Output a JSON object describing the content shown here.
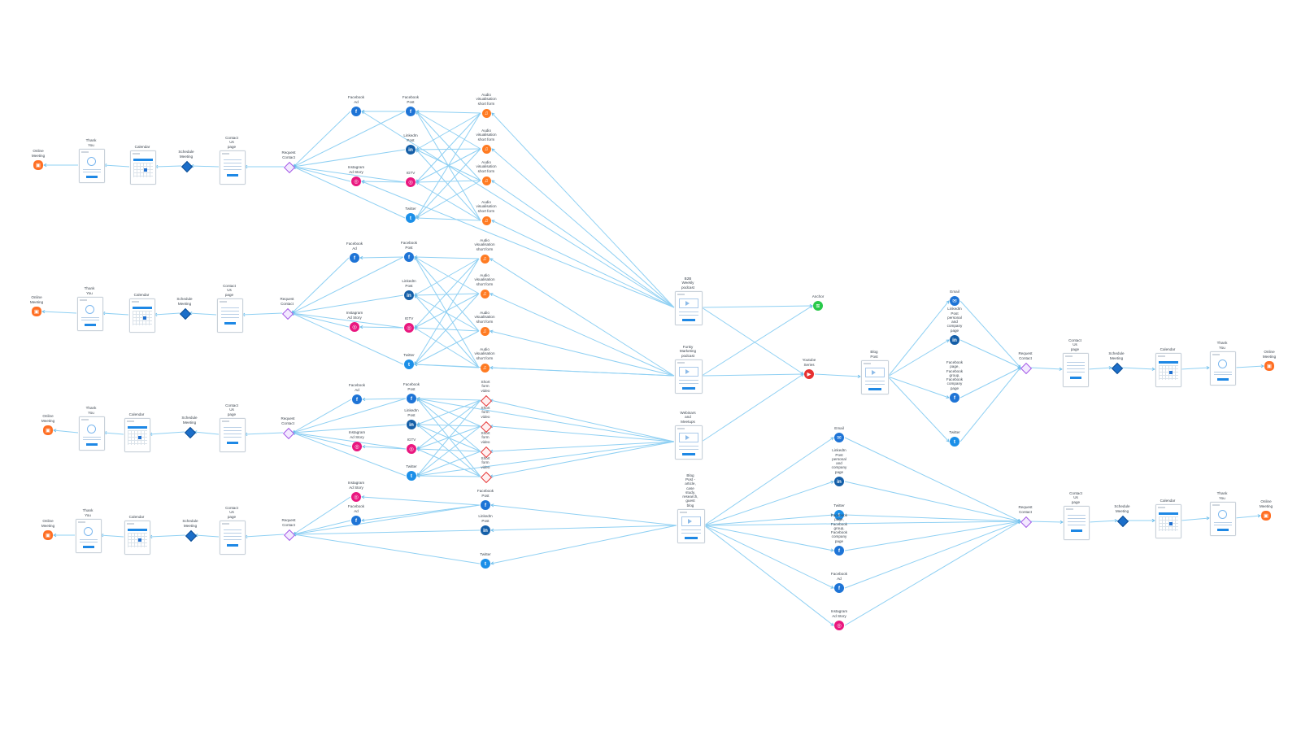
{
  "nodes": [
    {
      "id": "r1_mtg",
      "kind": "meeting",
      "label": "Online Meeting"
    },
    {
      "id": "r1_ty",
      "kind": "page-thanks",
      "label": "Thank You"
    },
    {
      "id": "r1_cal",
      "kind": "page-calendar",
      "label": "Calendar"
    },
    {
      "id": "r1_sch",
      "kind": "schedule",
      "label": "Schedule Meeting"
    },
    {
      "id": "r1_cu",
      "kind": "page-contact",
      "label": "Contact Us page"
    },
    {
      "id": "r1_rc",
      "kind": "request",
      "label": "Request Contact"
    },
    {
      "id": "r1_fbad",
      "kind": "fb",
      "label": "Facebook Ad"
    },
    {
      "id": "r1_igad",
      "kind": "ig",
      "label": "Instagram Ad Story"
    },
    {
      "id": "r1_fbp",
      "kind": "fb",
      "label": "Facebook Post"
    },
    {
      "id": "r1_li",
      "kind": "li",
      "label": "LinkedIn Post"
    },
    {
      "id": "r1_igtv",
      "kind": "ig",
      "label": "IGTV"
    },
    {
      "id": "r1_tw",
      "kind": "tw",
      "label": "Twitter"
    },
    {
      "id": "r1_a1",
      "kind": "audio",
      "label": "Audio visualisation\nshort form"
    },
    {
      "id": "r1_a2",
      "kind": "audio",
      "label": "Audio visualisation\nshort form"
    },
    {
      "id": "r1_a3",
      "kind": "audio",
      "label": "Audio visualisation\nshort form"
    },
    {
      "id": "r1_a4",
      "kind": "audio",
      "label": "Audio visualisation\nshort form"
    },
    {
      "id": "r2_mtg",
      "kind": "meeting",
      "label": "Online Meeting"
    },
    {
      "id": "r2_ty",
      "kind": "page-thanks",
      "label": "Thank You"
    },
    {
      "id": "r2_cal",
      "kind": "page-calendar",
      "label": "Calendar"
    },
    {
      "id": "r2_sch",
      "kind": "schedule",
      "label": "Schedule Meeting"
    },
    {
      "id": "r2_cu",
      "kind": "page-contact",
      "label": "Contact Us page"
    },
    {
      "id": "r2_rc",
      "kind": "request",
      "label": "Request Contact"
    },
    {
      "id": "r2_fbad",
      "kind": "fb",
      "label": "Facebook Ad"
    },
    {
      "id": "r2_igad",
      "kind": "ig",
      "label": "Instagram Ad Story"
    },
    {
      "id": "r2_fbp",
      "kind": "fb",
      "label": "Facebook Post"
    },
    {
      "id": "r2_li",
      "kind": "li",
      "label": "LinkedIn Post"
    },
    {
      "id": "r2_igtv",
      "kind": "ig",
      "label": "IGTV"
    },
    {
      "id": "r2_tw",
      "kind": "tw",
      "label": "Twitter"
    },
    {
      "id": "r2_a1",
      "kind": "audio",
      "label": "Audio visualisation\nshort form"
    },
    {
      "id": "r2_a2",
      "kind": "audio",
      "label": "Audio visualisation\nshort form"
    },
    {
      "id": "r2_a3",
      "kind": "audio",
      "label": "Audio visualisation\nshort form"
    },
    {
      "id": "r2_a4",
      "kind": "audio",
      "label": "Audio visualisation\nshort form"
    },
    {
      "id": "r3_mtg",
      "kind": "meeting",
      "label": "Online Meeting"
    },
    {
      "id": "r3_ty",
      "kind": "page-thanks",
      "label": "Thank You"
    },
    {
      "id": "r3_cal",
      "kind": "page-calendar",
      "label": "Calendar"
    },
    {
      "id": "r3_sch",
      "kind": "schedule",
      "label": "Schedule Meeting"
    },
    {
      "id": "r3_cu",
      "kind": "page-contact",
      "label": "Contact Us page"
    },
    {
      "id": "r3_rc",
      "kind": "request",
      "label": "Request Contact"
    },
    {
      "id": "r3_fbad",
      "kind": "fb",
      "label": "Facebook Ad"
    },
    {
      "id": "r3_igad",
      "kind": "ig",
      "label": "Instagram Ad Story"
    },
    {
      "id": "r3_fbp",
      "kind": "fb",
      "label": "Facebook Post"
    },
    {
      "id": "r3_li",
      "kind": "li",
      "label": "LinkedIn Post"
    },
    {
      "id": "r3_igtv",
      "kind": "ig",
      "label": "IGTV"
    },
    {
      "id": "r3_tw",
      "kind": "tw",
      "label": "Twitter"
    },
    {
      "id": "r3_s1",
      "kind": "video",
      "label": "Short form video"
    },
    {
      "id": "r3_s2",
      "kind": "video",
      "label": "Short form video"
    },
    {
      "id": "r3_s3",
      "kind": "video",
      "label": "Short form video"
    },
    {
      "id": "r3_s4",
      "kind": "video",
      "label": "Short form video"
    },
    {
      "id": "r4_mtg",
      "kind": "meeting",
      "label": "Online Meeting"
    },
    {
      "id": "r4_ty",
      "kind": "page-thanks",
      "label": "Thank You"
    },
    {
      "id": "r4_cal",
      "kind": "page-calendar",
      "label": "Calendar"
    },
    {
      "id": "r4_sch",
      "kind": "schedule",
      "label": "Schedule Meeting"
    },
    {
      "id": "r4_cu",
      "kind": "page-contact",
      "label": "Contact Us page"
    },
    {
      "id": "r4_rc",
      "kind": "request",
      "label": "Request Contact"
    },
    {
      "id": "r4_igad",
      "kind": "ig",
      "label": "Instagram Ad Story"
    },
    {
      "id": "r4_fbad",
      "kind": "fb",
      "label": "Facebook Ad"
    },
    {
      "id": "r4_fbp",
      "kind": "fb",
      "label": "Facebook Post"
    },
    {
      "id": "r4_li",
      "kind": "li",
      "label": "LinkedIn Post"
    },
    {
      "id": "r4_tw",
      "kind": "tw",
      "label": "Twitter"
    },
    {
      "id": "pod_b2b",
      "kind": "page-media",
      "label": "B2B Weekly podcast"
    },
    {
      "id": "pod_funky",
      "kind": "page-media",
      "label": "Funky Marketing podcast"
    },
    {
      "id": "webinar",
      "kind": "page-media",
      "label": "Webinars and Meetups"
    },
    {
      "id": "blog_long",
      "kind": "page-media",
      "label": "Blog Post - article, case study, research, guest blog"
    },
    {
      "id": "anchor",
      "kind": "anchor",
      "label": "Anchor"
    },
    {
      "id": "yt",
      "kind": "youtube",
      "label": "Youtube Series"
    },
    {
      "id": "blog",
      "kind": "page-media",
      "label": "Blog Post"
    },
    {
      "id": "u_email",
      "kind": "email",
      "label": "Email"
    },
    {
      "id": "u_li",
      "kind": "li",
      "label": "LinkedIn Post personal and\ncompany page"
    },
    {
      "id": "u_fb",
      "kind": "fb",
      "label": "Facebook page, Facebook\ngroup, Facebook company\npage"
    },
    {
      "id": "u_tw",
      "kind": "tw",
      "label": "Twitter"
    },
    {
      "id": "u_rc",
      "kind": "request",
      "label": "Request Contact"
    },
    {
      "id": "u_cu",
      "kind": "page-contact",
      "label": "Contact Us page"
    },
    {
      "id": "u_sch",
      "kind": "schedule",
      "label": "Schedule Meeting"
    },
    {
      "id": "u_cal",
      "kind": "page-calendar",
      "label": "Calendar"
    },
    {
      "id": "u_ty",
      "kind": "page-thanks",
      "label": "Thank You"
    },
    {
      "id": "u_mtg",
      "kind": "meeting",
      "label": "Online Meeting"
    },
    {
      "id": "l_email",
      "kind": "email",
      "label": "Email"
    },
    {
      "id": "l_li",
      "kind": "li",
      "label": "LinkedIn Post personal and\ncompany page"
    },
    {
      "id": "l_tw",
      "kind": "tw",
      "label": "Twitter"
    },
    {
      "id": "l_fb",
      "kind": "fb",
      "label": "Facebook page, Facebook\ngroup, Facebook company\npage"
    },
    {
      "id": "l_fbad",
      "kind": "fb",
      "label": "Facebook Ad"
    },
    {
      "id": "l_igad",
      "kind": "ig",
      "label": "Instagram Ad Story"
    },
    {
      "id": "l_rc",
      "kind": "request",
      "label": "Request Contact"
    },
    {
      "id": "l_cu",
      "kind": "page-contact",
      "label": "Contact Us page"
    },
    {
      "id": "l_sch",
      "kind": "schedule",
      "label": "Schedule Meeting"
    },
    {
      "id": "l_cal",
      "kind": "page-calendar",
      "label": "Calendar"
    },
    {
      "id": "l_ty",
      "kind": "page-thanks",
      "label": "Thank You"
    },
    {
      "id": "l_mtg",
      "kind": "meeting",
      "label": "Online Meeting"
    }
  ],
  "edges": [
    [
      "r1_ty",
      "r1_mtg"
    ],
    [
      "r1_cal",
      "r1_ty"
    ],
    [
      "r1_sch",
      "r1_cal"
    ],
    [
      "r1_cu",
      "r1_sch"
    ],
    [
      "r1_rc",
      "r1_cu"
    ],
    [
      "r1_fbad",
      "r1_rc"
    ],
    [
      "r1_igad",
      "r1_rc"
    ],
    [
      "r1_fbp",
      "r1_rc"
    ],
    [
      "r1_li",
      "r1_rc"
    ],
    [
      "r1_igtv",
      "r1_rc"
    ],
    [
      "r1_tw",
      "r1_rc"
    ],
    [
      "r1_fbp",
      "r1_fbad"
    ],
    [
      "r1_igtv",
      "r1_igad"
    ],
    [
      "r1_a1",
      "r1_fbp"
    ],
    [
      "r1_a1",
      "r1_li"
    ],
    [
      "r1_a1",
      "r1_igtv"
    ],
    [
      "r1_a1",
      "r1_tw"
    ],
    [
      "r1_a2",
      "r1_fbp"
    ],
    [
      "r1_a2",
      "r1_li"
    ],
    [
      "r1_a2",
      "r1_igtv"
    ],
    [
      "r1_a2",
      "r1_tw"
    ],
    [
      "r1_a3",
      "r1_fbp"
    ],
    [
      "r1_a3",
      "r1_li"
    ],
    [
      "r1_a3",
      "r1_igtv"
    ],
    [
      "r1_a3",
      "r1_tw"
    ],
    [
      "r1_a4",
      "r1_fbp"
    ],
    [
      "r1_a4",
      "r1_li"
    ],
    [
      "r1_a4",
      "r1_igtv"
    ],
    [
      "r1_a4",
      "r1_tw"
    ],
    [
      "pod_b2b",
      "r1_a1"
    ],
    [
      "pod_b2b",
      "r1_a2"
    ],
    [
      "pod_b2b",
      "r1_a3"
    ],
    [
      "pod_b2b",
      "r1_a4"
    ],
    [
      "pod_b2b",
      "r1_fbad"
    ],
    [
      "pod_b2b",
      "r1_igad"
    ],
    [
      "r2_ty",
      "r2_mtg"
    ],
    [
      "r2_cal",
      "r2_ty"
    ],
    [
      "r2_sch",
      "r2_cal"
    ],
    [
      "r2_cu",
      "r2_sch"
    ],
    [
      "r2_rc",
      "r2_cu"
    ],
    [
      "r2_fbad",
      "r2_rc"
    ],
    [
      "r2_igad",
      "r2_rc"
    ],
    [
      "r2_fbp",
      "r2_rc"
    ],
    [
      "r2_li",
      "r2_rc"
    ],
    [
      "r2_igtv",
      "r2_rc"
    ],
    [
      "r2_tw",
      "r2_rc"
    ],
    [
      "r2_fbp",
      "r2_fbad"
    ],
    [
      "r2_igtv",
      "r2_igad"
    ],
    [
      "r2_a1",
      "r2_fbp"
    ],
    [
      "r2_a1",
      "r2_li"
    ],
    [
      "r2_a1",
      "r2_igtv"
    ],
    [
      "r2_a1",
      "r2_tw"
    ],
    [
      "r2_a2",
      "r2_fbp"
    ],
    [
      "r2_a2",
      "r2_li"
    ],
    [
      "r2_a2",
      "r2_igtv"
    ],
    [
      "r2_a2",
      "r2_tw"
    ],
    [
      "r2_a3",
      "r2_fbp"
    ],
    [
      "r2_a3",
      "r2_li"
    ],
    [
      "r2_a3",
      "r2_igtv"
    ],
    [
      "r2_a3",
      "r2_tw"
    ],
    [
      "r2_a4",
      "r2_fbp"
    ],
    [
      "r2_a4",
      "r2_li"
    ],
    [
      "r2_a4",
      "r2_igtv"
    ],
    [
      "r2_a4",
      "r2_tw"
    ],
    [
      "pod_funky",
      "r2_a1"
    ],
    [
      "pod_funky",
      "r2_a2"
    ],
    [
      "pod_funky",
      "r2_a3"
    ],
    [
      "pod_funky",
      "r2_a4"
    ],
    [
      "pod_funky",
      "r2_tw"
    ],
    [
      "r3_ty",
      "r3_mtg"
    ],
    [
      "r3_cal",
      "r3_ty"
    ],
    [
      "r3_sch",
      "r3_cal"
    ],
    [
      "r3_cu",
      "r3_sch"
    ],
    [
      "r3_rc",
      "r3_cu"
    ],
    [
      "r3_fbad",
      "r3_rc"
    ],
    [
      "r3_igad",
      "r3_rc"
    ],
    [
      "r3_fbp",
      "r3_rc"
    ],
    [
      "r3_li",
      "r3_rc"
    ],
    [
      "r3_igtv",
      "r3_rc"
    ],
    [
      "r3_tw",
      "r3_rc"
    ],
    [
      "r3_fbp",
      "r3_fbad"
    ],
    [
      "r3_igtv",
      "r3_igad"
    ],
    [
      "r3_s1",
      "r3_fbp"
    ],
    [
      "r3_s1",
      "r3_li"
    ],
    [
      "r3_s1",
      "r3_igtv"
    ],
    [
      "r3_s1",
      "r3_tw"
    ],
    [
      "r3_s2",
      "r3_fbp"
    ],
    [
      "r3_s2",
      "r3_li"
    ],
    [
      "r3_s2",
      "r3_igtv"
    ],
    [
      "r3_s2",
      "r3_tw"
    ],
    [
      "r3_s3",
      "r3_fbp"
    ],
    [
      "r3_s3",
      "r3_li"
    ],
    [
      "r3_s3",
      "r3_igtv"
    ],
    [
      "r3_s3",
      "r3_tw"
    ],
    [
      "r3_s4",
      "r3_fbp"
    ],
    [
      "r3_s4",
      "r3_li"
    ],
    [
      "r3_s4",
      "r3_igtv"
    ],
    [
      "r3_s4",
      "r3_tw"
    ],
    [
      "webinar",
      "r3_s1"
    ],
    [
      "webinar",
      "r3_s2"
    ],
    [
      "webinar",
      "r3_s3"
    ],
    [
      "webinar",
      "r3_s4"
    ],
    [
      "webinar",
      "r3_fbp"
    ],
    [
      "webinar",
      "r3_tw"
    ],
    [
      "r4_ty",
      "r4_mtg"
    ],
    [
      "r4_cal",
      "r4_ty"
    ],
    [
      "r4_sch",
      "r4_cal"
    ],
    [
      "r4_cu",
      "r4_sch"
    ],
    [
      "r4_rc",
      "r4_cu"
    ],
    [
      "r4_igad",
      "r4_rc"
    ],
    [
      "r4_fbad",
      "r4_rc"
    ],
    [
      "r4_fbp",
      "r4_rc"
    ],
    [
      "r4_li",
      "r4_rc"
    ],
    [
      "r4_tw",
      "r4_rc"
    ],
    [
      "r4_fbp",
      "r4_igad"
    ],
    [
      "r4_fbp",
      "r4_fbad"
    ],
    [
      "blog_long",
      "r4_fbp"
    ],
    [
      "blog_long",
      "r4_li"
    ],
    [
      "blog_long",
      "r4_tw"
    ],
    [
      "pod_b2b",
      "anchor"
    ],
    [
      "pod_funky",
      "anchor"
    ],
    [
      "pod_b2b",
      "yt"
    ],
    [
      "pod_funky",
      "yt"
    ],
    [
      "webinar",
      "yt"
    ],
    [
      "yt",
      "blog"
    ],
    [
      "blog",
      "u_email"
    ],
    [
      "blog",
      "u_li"
    ],
    [
      "blog",
      "u_fb"
    ],
    [
      "blog",
      "u_tw"
    ],
    [
      "u_email",
      "u_rc"
    ],
    [
      "u_li",
      "u_rc"
    ],
    [
      "u_fb",
      "u_rc"
    ],
    [
      "u_tw",
      "u_rc"
    ],
    [
      "u_rc",
      "u_cu"
    ],
    [
      "u_cu",
      "u_sch"
    ],
    [
      "u_sch",
      "u_cal"
    ],
    [
      "u_cal",
      "u_ty"
    ],
    [
      "u_ty",
      "u_mtg"
    ],
    [
      "blog_long",
      "l_email"
    ],
    [
      "blog_long",
      "l_li"
    ],
    [
      "blog_long",
      "l_tw"
    ],
    [
      "blog_long",
      "l_fb"
    ],
    [
      "blog_long",
      "l_fbad"
    ],
    [
      "blog_long",
      "l_igad"
    ],
    [
      "l_email",
      "l_rc"
    ],
    [
      "l_li",
      "l_rc"
    ],
    [
      "l_tw",
      "l_rc"
    ],
    [
      "l_fb",
      "l_rc"
    ],
    [
      "l_fbad",
      "l_rc"
    ],
    [
      "l_igad",
      "l_rc"
    ],
    [
      "blog_long",
      "l_rc"
    ],
    [
      "l_rc",
      "l_cu"
    ],
    [
      "l_cu",
      "l_sch"
    ],
    [
      "l_sch",
      "l_cal"
    ],
    [
      "l_cal",
      "l_ty"
    ],
    [
      "l_ty",
      "l_mtg"
    ]
  ],
  "colors": {
    "edge": "#8fd0f3",
    "facebook": "#1e74d6",
    "linkedin": "#155fa8",
    "twitter": "#1b8fe8",
    "instagram": "#e9177f",
    "meeting": "#ff6f24",
    "audio": "#ff7b22",
    "anchor": "#28c94a",
    "youtube": "#e63031",
    "request": "#a45be6",
    "schedule": "#1b6ec9"
  }
}
